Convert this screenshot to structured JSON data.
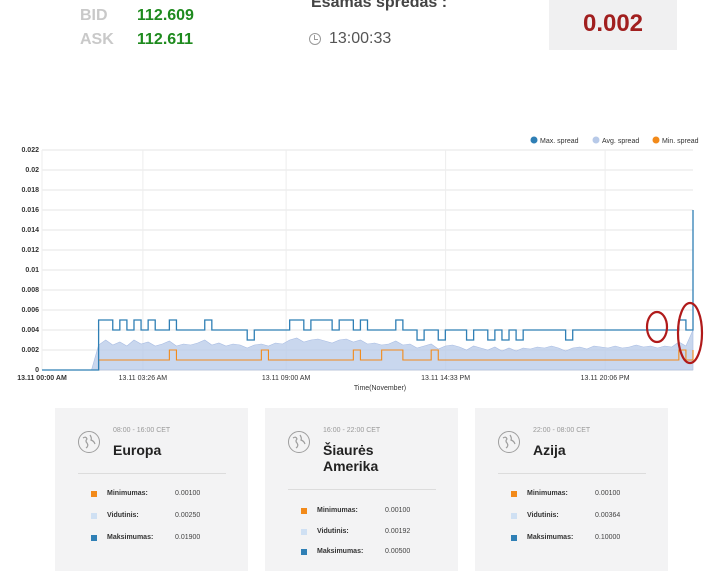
{
  "ticker": {
    "bid_label": "BID",
    "bid_value": "112.609",
    "ask_label": "ASK",
    "ask_value": "112.611",
    "current_spread_label": "Esamas spredas :",
    "time": "13:00:33",
    "current_spread_value": "0.002"
  },
  "chart_data": {
    "type": "line",
    "title": "",
    "xlabel": "Time(November)",
    "ylabel": "",
    "ylim": [
      0,
      0.022
    ],
    "y_ticks": [
      "0",
      "0.002",
      "0.004",
      "0.006",
      "0.008",
      "0.01",
      "0.012",
      "0.014",
      "0.016",
      "0.018",
      "0.02",
      "0.022"
    ],
    "x_ticks": [
      "13.11 00:00 AM",
      "13.11 03:26 AM",
      "13.11 09:00 AM",
      "13.11 14:33 PM",
      "13.11 20:06 PM"
    ],
    "grid": true,
    "legend_placement": "top-right",
    "colors": {
      "max": "#2f7fb5",
      "avg": "#b7c9e8",
      "min": "#f28a1a",
      "annotation": "#b01a1a"
    },
    "series": [
      {
        "name": "Max. spread",
        "style": "line",
        "values": [
          0,
          0,
          0,
          0,
          0,
          0,
          0,
          0,
          0.005,
          0.005,
          0.004,
          0.005,
          0.004,
          0.005,
          0.004,
          0.005,
          0.004,
          0.004,
          0.005,
          0.004,
          0.004,
          0.004,
          0.004,
          0.005,
          0.004,
          0.004,
          0.004,
          0.004,
          0.004,
          0.003,
          0.004,
          0.004,
          0.004,
          0.004,
          0.004,
          0.005,
          0.005,
          0.004,
          0.005,
          0.005,
          0.005,
          0.004,
          0.005,
          0.005,
          0.004,
          0.005,
          0.004,
          0.004,
          0.004,
          0.004,
          0.005,
          0.004,
          0.004,
          0.003,
          0.004,
          0.004,
          0.003,
          0.004,
          0.004,
          0.004,
          0.003,
          0.004,
          0.004,
          0.003,
          0.004,
          0.003,
          0.004,
          0.003,
          0.004,
          0.004,
          0.004,
          0.004,
          0.004,
          0.004,
          0.003,
          0.004,
          0.004,
          0.004,
          0.004,
          0.004,
          0.004,
          0.004,
          0.004,
          0.004,
          0.004,
          0.004,
          0.004,
          0.004,
          0.004,
          0.004,
          0.005,
          0.004,
          0.016
        ]
      },
      {
        "name": "Avg. spread",
        "style": "area",
        "values": [
          0,
          0,
          0,
          0,
          0,
          0,
          0,
          0,
          0.0025,
          0.003,
          0.0025,
          0.0028,
          0.0024,
          0.003,
          0.0026,
          0.0028,
          0.0024,
          0.0026,
          0.0029,
          0.0024,
          0.0026,
          0.0025,
          0.0027,
          0.003,
          0.0025,
          0.0027,
          0.0024,
          0.0026,
          0.0025,
          0.0022,
          0.0025,
          0.0026,
          0.0024,
          0.0027,
          0.0026,
          0.003,
          0.0032,
          0.0028,
          0.003,
          0.0031,
          0.0029,
          0.0027,
          0.003,
          0.0031,
          0.0028,
          0.003,
          0.0026,
          0.0027,
          0.0025,
          0.0026,
          0.0029,
          0.0025,
          0.0026,
          0.0022,
          0.0024,
          0.0026,
          0.0021,
          0.0024,
          0.0025,
          0.0023,
          0.002,
          0.0024,
          0.0022,
          0.002,
          0.0023,
          0.0019,
          0.0022,
          0.0019,
          0.0022,
          0.0021,
          0.0023,
          0.0022,
          0.0024,
          0.0022,
          0.0019,
          0.0022,
          0.0023,
          0.0021,
          0.0024,
          0.0023,
          0.0022,
          0.0024,
          0.0022,
          0.0023,
          0.0025,
          0.0023,
          0.0024,
          0.0022,
          0.0024,
          0.0023,
          0.0028,
          0.0024,
          0.004
        ]
      },
      {
        "name": "Min. spread",
        "style": "line",
        "values": [
          0,
          0,
          0,
          0,
          0,
          0,
          0,
          0,
          0.001,
          0.001,
          0.001,
          0.001,
          0.001,
          0.001,
          0.001,
          0.001,
          0.001,
          0.001,
          0.002,
          0.001,
          0.001,
          0.001,
          0.001,
          0.001,
          0.001,
          0.001,
          0.001,
          0.001,
          0.001,
          0.001,
          0.001,
          0.002,
          0.001,
          0.001,
          0.001,
          0.001,
          0.001,
          0.001,
          0.001,
          0.001,
          0.001,
          0.001,
          0.001,
          0.001,
          0.002,
          0.001,
          0.001,
          0.001,
          0.002,
          0.002,
          0.002,
          0.001,
          0.001,
          0.001,
          0.001,
          0.002,
          0.001,
          0.001,
          0.001,
          0.001,
          0.001,
          0.001,
          0.001,
          0.001,
          0.001,
          0.001,
          0.001,
          0.001,
          0.001,
          0.001,
          0.001,
          0.001,
          0.001,
          0.001,
          0.001,
          0.001,
          0.001,
          0.001,
          0.001,
          0.001,
          0.001,
          0.001,
          0.001,
          0.001,
          0.001,
          0.001,
          0.001,
          0.001,
          0.001,
          0.001,
          0.002,
          0.001,
          0.002
        ]
      }
    ]
  },
  "sessions": [
    {
      "hours": "08:00 - 16:00 CET",
      "region_line1": "Europa",
      "region_line2": "",
      "min_label": "Minimumas:",
      "min_value": "0.00100",
      "avg_label": "Vidutinis:",
      "avg_value": "0.00250",
      "max_label": "Maksimumas:",
      "max_value": "0.01900"
    },
    {
      "hours": "16:00 - 22:00 CET",
      "region_line1": "Šiaurės",
      "region_line2": "Amerika",
      "min_label": "Minimumas:",
      "min_value": "0.00100",
      "avg_label": "Vidutinis:",
      "avg_value": "0.00192",
      "max_label": "Maksimumas:",
      "max_value": "0.00500"
    },
    {
      "hours": "22:00 - 08:00 CET",
      "region_line1": "Azija",
      "region_line2": "",
      "min_label": "Minimumas:",
      "min_value": "0.00100",
      "avg_label": "Vidutinis:",
      "avg_value": "0.00364",
      "max_label": "Maksimumas:",
      "max_value": "0.10000"
    }
  ]
}
